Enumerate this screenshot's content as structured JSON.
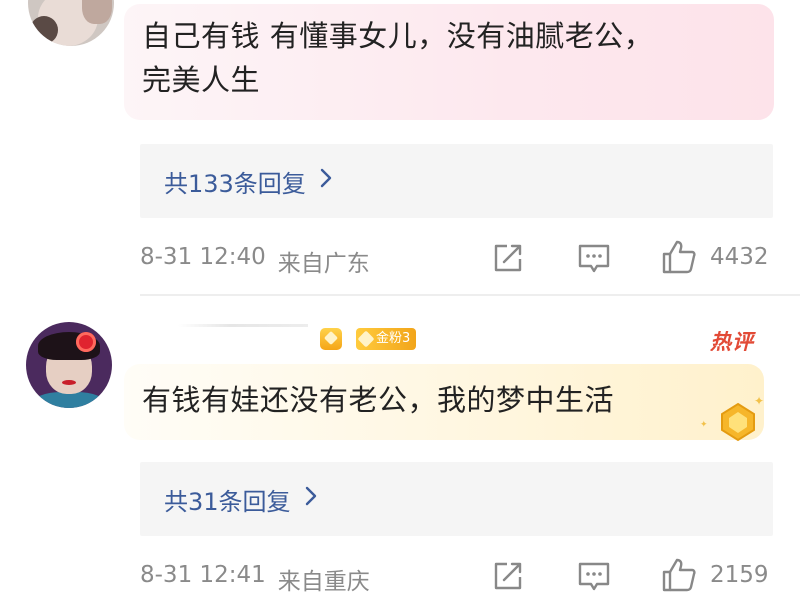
{
  "comments": [
    {
      "text_line1": "自己有钱 有懂事女儿，没有油腻老公，",
      "text_line2": "完美人生",
      "replies_label": "共133条回复",
      "date": "8-31 12:40",
      "location": "来自广东",
      "likes": "4432",
      "bubble_colors": [
        "#fdf5f7",
        "#fde3ea"
      ]
    },
    {
      "text": "有钱有娃还没有老公，我的梦中生活",
      "replies_label": "共31条回复",
      "date": "8-31 12:41",
      "location": "来自重庆",
      "likes": "2159",
      "fan_badge": "金粉3",
      "hot_tag": "热评",
      "bubble_colors": [
        "#fffdf7",
        "#fff1cc"
      ]
    }
  ],
  "icons": {
    "share": "share-icon",
    "comment": "comment-icon",
    "like": "thumbs-up-icon",
    "chevron": "chevron-right-icon",
    "medal": "gold-medal-icon"
  },
  "colors": {
    "link": "#3b5b9a",
    "meta": "#8a8a8a",
    "hot_tag": "#e24a36",
    "badge_gold": "#f5a516"
  }
}
